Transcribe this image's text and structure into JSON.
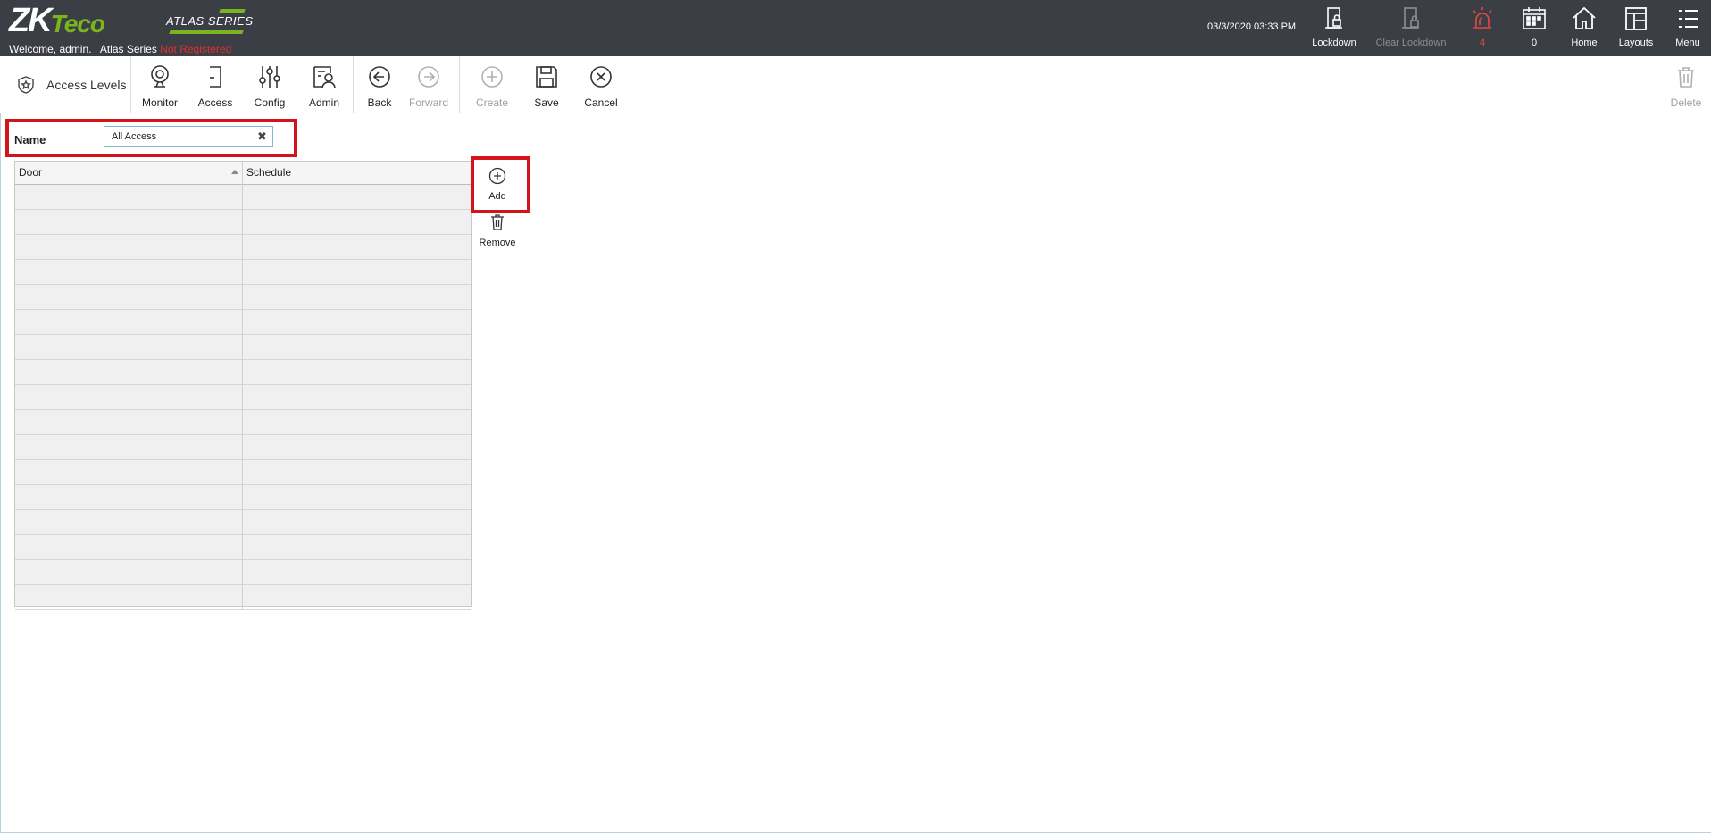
{
  "header": {
    "logo_main": "ZK",
    "logo_accent": "Teco",
    "series_badge": "ATLAS SERIES",
    "welcome": "Welcome, admin.",
    "product": "Atlas Series",
    "registration": "Not Registered",
    "datetime": "03/3/2020 03:33 PM",
    "buttons": {
      "lockdown": "Lockdown",
      "clear_lockdown": "Clear Lockdown",
      "alarms_count": "4",
      "events_count": "0",
      "home": "Home",
      "layouts": "Layouts",
      "menu": "Menu"
    }
  },
  "toolbar": {
    "page_title": "Access Levels",
    "monitor": "Monitor",
    "access": "Access",
    "config": "Config",
    "admin": "Admin",
    "back": "Back",
    "forward": "Forward",
    "create": "Create",
    "save": "Save",
    "cancel": "Cancel",
    "delete": "Delete"
  },
  "form": {
    "name_label": "Name",
    "name_value": "All Access"
  },
  "grid": {
    "columns": [
      "Door",
      "Schedule"
    ],
    "rows": []
  },
  "side_actions": {
    "add": "Add",
    "remove": "Remove"
  },
  "colors": {
    "topbar": "#3b3f45",
    "accent_green": "#7ab51d",
    "highlight_red": "#d4141b",
    "alarm_red": "#e8473f"
  }
}
